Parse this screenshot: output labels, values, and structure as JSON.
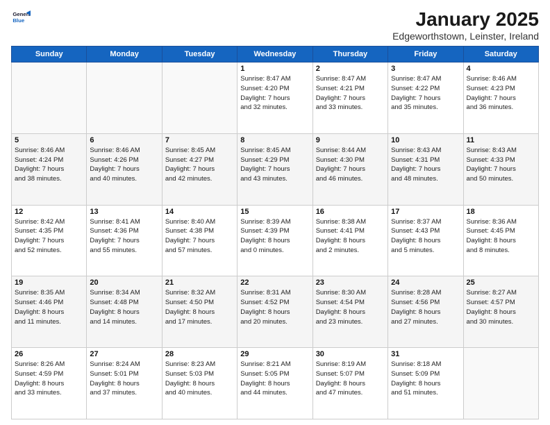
{
  "header": {
    "logo_general": "General",
    "logo_blue": "Blue",
    "title": "January 2025",
    "subtitle": "Edgeworthstown, Leinster, Ireland"
  },
  "days_of_week": [
    "Sunday",
    "Monday",
    "Tuesday",
    "Wednesday",
    "Thursday",
    "Friday",
    "Saturday"
  ],
  "weeks": [
    [
      {
        "day": "",
        "info": ""
      },
      {
        "day": "",
        "info": ""
      },
      {
        "day": "",
        "info": ""
      },
      {
        "day": "1",
        "info": "Sunrise: 8:47 AM\nSunset: 4:20 PM\nDaylight: 7 hours\nand 32 minutes."
      },
      {
        "day": "2",
        "info": "Sunrise: 8:47 AM\nSunset: 4:21 PM\nDaylight: 7 hours\nand 33 minutes."
      },
      {
        "day": "3",
        "info": "Sunrise: 8:47 AM\nSunset: 4:22 PM\nDaylight: 7 hours\nand 35 minutes."
      },
      {
        "day": "4",
        "info": "Sunrise: 8:46 AM\nSunset: 4:23 PM\nDaylight: 7 hours\nand 36 minutes."
      }
    ],
    [
      {
        "day": "5",
        "info": "Sunrise: 8:46 AM\nSunset: 4:24 PM\nDaylight: 7 hours\nand 38 minutes."
      },
      {
        "day": "6",
        "info": "Sunrise: 8:46 AM\nSunset: 4:26 PM\nDaylight: 7 hours\nand 40 minutes."
      },
      {
        "day": "7",
        "info": "Sunrise: 8:45 AM\nSunset: 4:27 PM\nDaylight: 7 hours\nand 42 minutes."
      },
      {
        "day": "8",
        "info": "Sunrise: 8:45 AM\nSunset: 4:29 PM\nDaylight: 7 hours\nand 43 minutes."
      },
      {
        "day": "9",
        "info": "Sunrise: 8:44 AM\nSunset: 4:30 PM\nDaylight: 7 hours\nand 46 minutes."
      },
      {
        "day": "10",
        "info": "Sunrise: 8:43 AM\nSunset: 4:31 PM\nDaylight: 7 hours\nand 48 minutes."
      },
      {
        "day": "11",
        "info": "Sunrise: 8:43 AM\nSunset: 4:33 PM\nDaylight: 7 hours\nand 50 minutes."
      }
    ],
    [
      {
        "day": "12",
        "info": "Sunrise: 8:42 AM\nSunset: 4:35 PM\nDaylight: 7 hours\nand 52 minutes."
      },
      {
        "day": "13",
        "info": "Sunrise: 8:41 AM\nSunset: 4:36 PM\nDaylight: 7 hours\nand 55 minutes."
      },
      {
        "day": "14",
        "info": "Sunrise: 8:40 AM\nSunset: 4:38 PM\nDaylight: 7 hours\nand 57 minutes."
      },
      {
        "day": "15",
        "info": "Sunrise: 8:39 AM\nSunset: 4:39 PM\nDaylight: 8 hours\nand 0 minutes."
      },
      {
        "day": "16",
        "info": "Sunrise: 8:38 AM\nSunset: 4:41 PM\nDaylight: 8 hours\nand 2 minutes."
      },
      {
        "day": "17",
        "info": "Sunrise: 8:37 AM\nSunset: 4:43 PM\nDaylight: 8 hours\nand 5 minutes."
      },
      {
        "day": "18",
        "info": "Sunrise: 8:36 AM\nSunset: 4:45 PM\nDaylight: 8 hours\nand 8 minutes."
      }
    ],
    [
      {
        "day": "19",
        "info": "Sunrise: 8:35 AM\nSunset: 4:46 PM\nDaylight: 8 hours\nand 11 minutes."
      },
      {
        "day": "20",
        "info": "Sunrise: 8:34 AM\nSunset: 4:48 PM\nDaylight: 8 hours\nand 14 minutes."
      },
      {
        "day": "21",
        "info": "Sunrise: 8:32 AM\nSunset: 4:50 PM\nDaylight: 8 hours\nand 17 minutes."
      },
      {
        "day": "22",
        "info": "Sunrise: 8:31 AM\nSunset: 4:52 PM\nDaylight: 8 hours\nand 20 minutes."
      },
      {
        "day": "23",
        "info": "Sunrise: 8:30 AM\nSunset: 4:54 PM\nDaylight: 8 hours\nand 23 minutes."
      },
      {
        "day": "24",
        "info": "Sunrise: 8:28 AM\nSunset: 4:56 PM\nDaylight: 8 hours\nand 27 minutes."
      },
      {
        "day": "25",
        "info": "Sunrise: 8:27 AM\nSunset: 4:57 PM\nDaylight: 8 hours\nand 30 minutes."
      }
    ],
    [
      {
        "day": "26",
        "info": "Sunrise: 8:26 AM\nSunset: 4:59 PM\nDaylight: 8 hours\nand 33 minutes."
      },
      {
        "day": "27",
        "info": "Sunrise: 8:24 AM\nSunset: 5:01 PM\nDaylight: 8 hours\nand 37 minutes."
      },
      {
        "day": "28",
        "info": "Sunrise: 8:23 AM\nSunset: 5:03 PM\nDaylight: 8 hours\nand 40 minutes."
      },
      {
        "day": "29",
        "info": "Sunrise: 8:21 AM\nSunset: 5:05 PM\nDaylight: 8 hours\nand 44 minutes."
      },
      {
        "day": "30",
        "info": "Sunrise: 8:19 AM\nSunset: 5:07 PM\nDaylight: 8 hours\nand 47 minutes."
      },
      {
        "day": "31",
        "info": "Sunrise: 8:18 AM\nSunset: 5:09 PM\nDaylight: 8 hours\nand 51 minutes."
      },
      {
        "day": "",
        "info": ""
      }
    ]
  ]
}
